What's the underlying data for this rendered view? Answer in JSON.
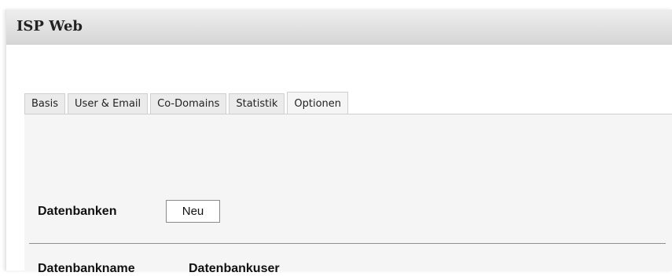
{
  "window": {
    "title": "ISP Web"
  },
  "tabs": [
    {
      "label": "Basis",
      "active": false
    },
    {
      "label": "User & Email",
      "active": false
    },
    {
      "label": "Co-Domains",
      "active": false
    },
    {
      "label": "Statistik",
      "active": false
    },
    {
      "label": "Optionen",
      "active": true
    }
  ],
  "databases": {
    "section_label": "Datenbanken",
    "new_button_label": "Neu",
    "columns": [
      "Datenbankname",
      "Datenbankuser"
    ]
  }
}
